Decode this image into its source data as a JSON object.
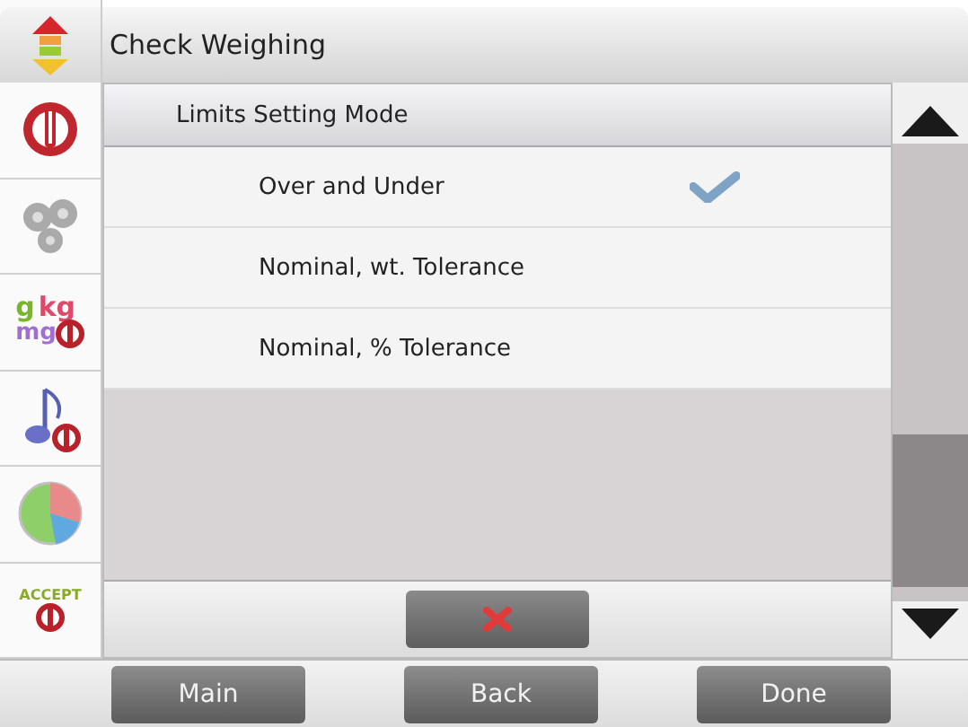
{
  "title_bar": {
    "title": "Check Weighing"
  },
  "sidebar": {
    "items": [
      {
        "kind": "power"
      },
      {
        "kind": "gears"
      },
      {
        "kind": "units",
        "texts": [
          "g",
          "kg",
          "mg"
        ]
      },
      {
        "kind": "sound"
      },
      {
        "kind": "pie"
      },
      {
        "kind": "accept",
        "texts": [
          "ACCEPT"
        ]
      }
    ]
  },
  "dialog": {
    "title": "Limits Setting Mode",
    "options": [
      {
        "label": "Over and Under",
        "selected": true
      },
      {
        "label": "Nominal, wt. Tolerance",
        "selected": false
      },
      {
        "label": "Nominal, % Tolerance",
        "selected": false
      }
    ]
  },
  "nav_buttons": [
    "Main",
    "Back",
    "Done"
  ]
}
